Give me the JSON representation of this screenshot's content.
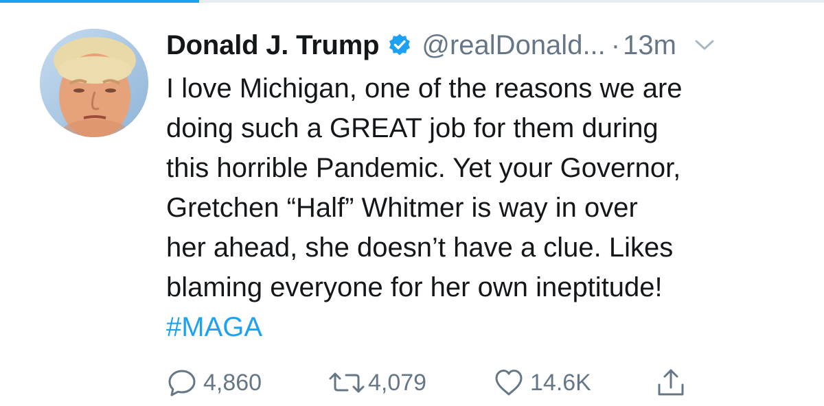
{
  "header": {
    "display_name": "Donald J. Trump",
    "handle": "@realDonald...",
    "separator": "·",
    "time": "13m",
    "verified": true,
    "caret_icon": "chevron-down-icon"
  },
  "tweet": {
    "lines": [
      "I love Michigan, one of the reasons we are",
      "doing such a GREAT job for them during",
      "this horrible Pandemic. Yet your Governor,",
      "Gretchen “Half” Whitmer is way in over",
      "her ahead, she doesn’t have a clue. Likes",
      "blaming everyone for her own ineptitude!"
    ],
    "hashtag": "#MAGA"
  },
  "actions": {
    "reply": {
      "icon": "reply-icon",
      "count": "4,860"
    },
    "retweet": {
      "icon": "retweet-icon",
      "count": "4,079"
    },
    "like": {
      "icon": "heart-icon",
      "count": "14.6K"
    },
    "share": {
      "icon": "share-icon"
    }
  },
  "colors": {
    "text": "#14171a",
    "secondary": "#657786",
    "accent": "#1da1f2"
  }
}
